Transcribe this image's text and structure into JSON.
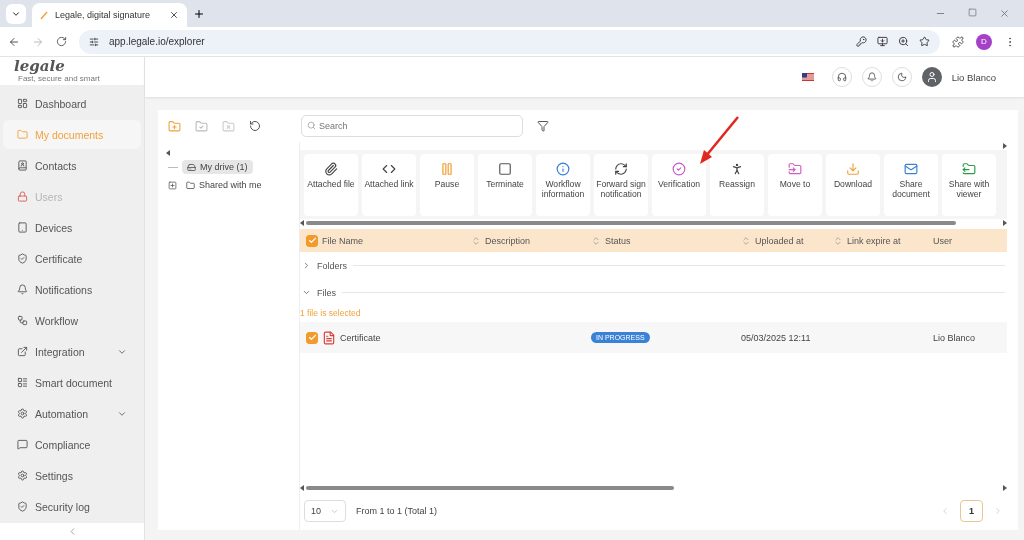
{
  "browser": {
    "tab_title": "Legale, digital signature",
    "url": "app.legale.io/explorer",
    "profile_initial": "D"
  },
  "logo": {
    "name": "legale",
    "tagline": "Fast, secure and smart"
  },
  "header": {
    "user": "Lio Blanco"
  },
  "sidebar": {
    "items": [
      {
        "label": "Dashboard",
        "selected": false,
        "disabled": false,
        "submenu": false
      },
      {
        "label": "My documents",
        "selected": true,
        "disabled": false,
        "submenu": false
      },
      {
        "label": "Contacts",
        "selected": false,
        "disabled": false,
        "submenu": false
      },
      {
        "label": "Users",
        "selected": false,
        "disabled": true,
        "submenu": false
      },
      {
        "label": "Devices",
        "selected": false,
        "disabled": false,
        "submenu": false
      },
      {
        "label": "Certificate",
        "selected": false,
        "disabled": false,
        "submenu": false
      },
      {
        "label": "Notifications",
        "selected": false,
        "disabled": false,
        "submenu": false
      },
      {
        "label": "Workflow",
        "selected": false,
        "disabled": false,
        "submenu": false
      },
      {
        "label": "Integration",
        "selected": false,
        "disabled": false,
        "submenu": true
      },
      {
        "label": "Smart document",
        "selected": false,
        "disabled": false,
        "submenu": false
      },
      {
        "label": "Automation",
        "selected": false,
        "disabled": false,
        "submenu": true
      },
      {
        "label": "Compliance",
        "selected": false,
        "disabled": false,
        "submenu": false
      },
      {
        "label": "Settings",
        "selected": false,
        "disabled": false,
        "submenu": false
      },
      {
        "label": "Security log",
        "selected": false,
        "disabled": false,
        "submenu": false
      }
    ]
  },
  "tree": [
    {
      "label": "My drive (1)",
      "selected": true,
      "expandable": false
    },
    {
      "label": "Shared with me",
      "selected": false,
      "expandable": true
    }
  ],
  "search": {
    "placeholder": "Search"
  },
  "actions": [
    {
      "label": "Attached file",
      "kind": "attach"
    },
    {
      "label": "Attached link",
      "kind": "code"
    },
    {
      "label": "Pause",
      "kind": "pause"
    },
    {
      "label": "Terminate",
      "kind": "stop"
    },
    {
      "label": "Workflow information",
      "kind": "info"
    },
    {
      "label": "Forward sign notification",
      "kind": "refresh"
    },
    {
      "label": "Verification",
      "kind": "verify"
    },
    {
      "label": "Reassign",
      "kind": "walk"
    },
    {
      "label": "Move to",
      "kind": "move"
    },
    {
      "label": "Download",
      "kind": "download"
    },
    {
      "label": "Share document",
      "kind": "mail"
    },
    {
      "label": "Share with viewer",
      "kind": "share"
    }
  ],
  "table": {
    "all_checked": true,
    "columns": [
      {
        "label": "File Name",
        "sortable": false
      },
      {
        "label": "Description",
        "sortable": true
      },
      {
        "label": "Status",
        "sortable": true
      },
      {
        "label": "Uploaded at",
        "sortable": true
      },
      {
        "label": "Link expire at",
        "sortable": true
      },
      {
        "label": "User",
        "sortable": false
      }
    ],
    "groups": [
      {
        "label": "Folders",
        "expanded": false
      },
      {
        "label": "Files",
        "expanded": true
      }
    ],
    "selection_note": "1 file is selected",
    "rows": [
      {
        "checked": true,
        "name": "Certificate",
        "status": "IN PROGRESS",
        "uploaded": "05/03/2025 12:11",
        "user": "Lio Blanco"
      }
    ]
  },
  "pagination": {
    "page_size": "10",
    "summary": "From 1 to 1 (Total 1)",
    "pages": [
      {
        "label": "1",
        "selected": true
      }
    ]
  }
}
